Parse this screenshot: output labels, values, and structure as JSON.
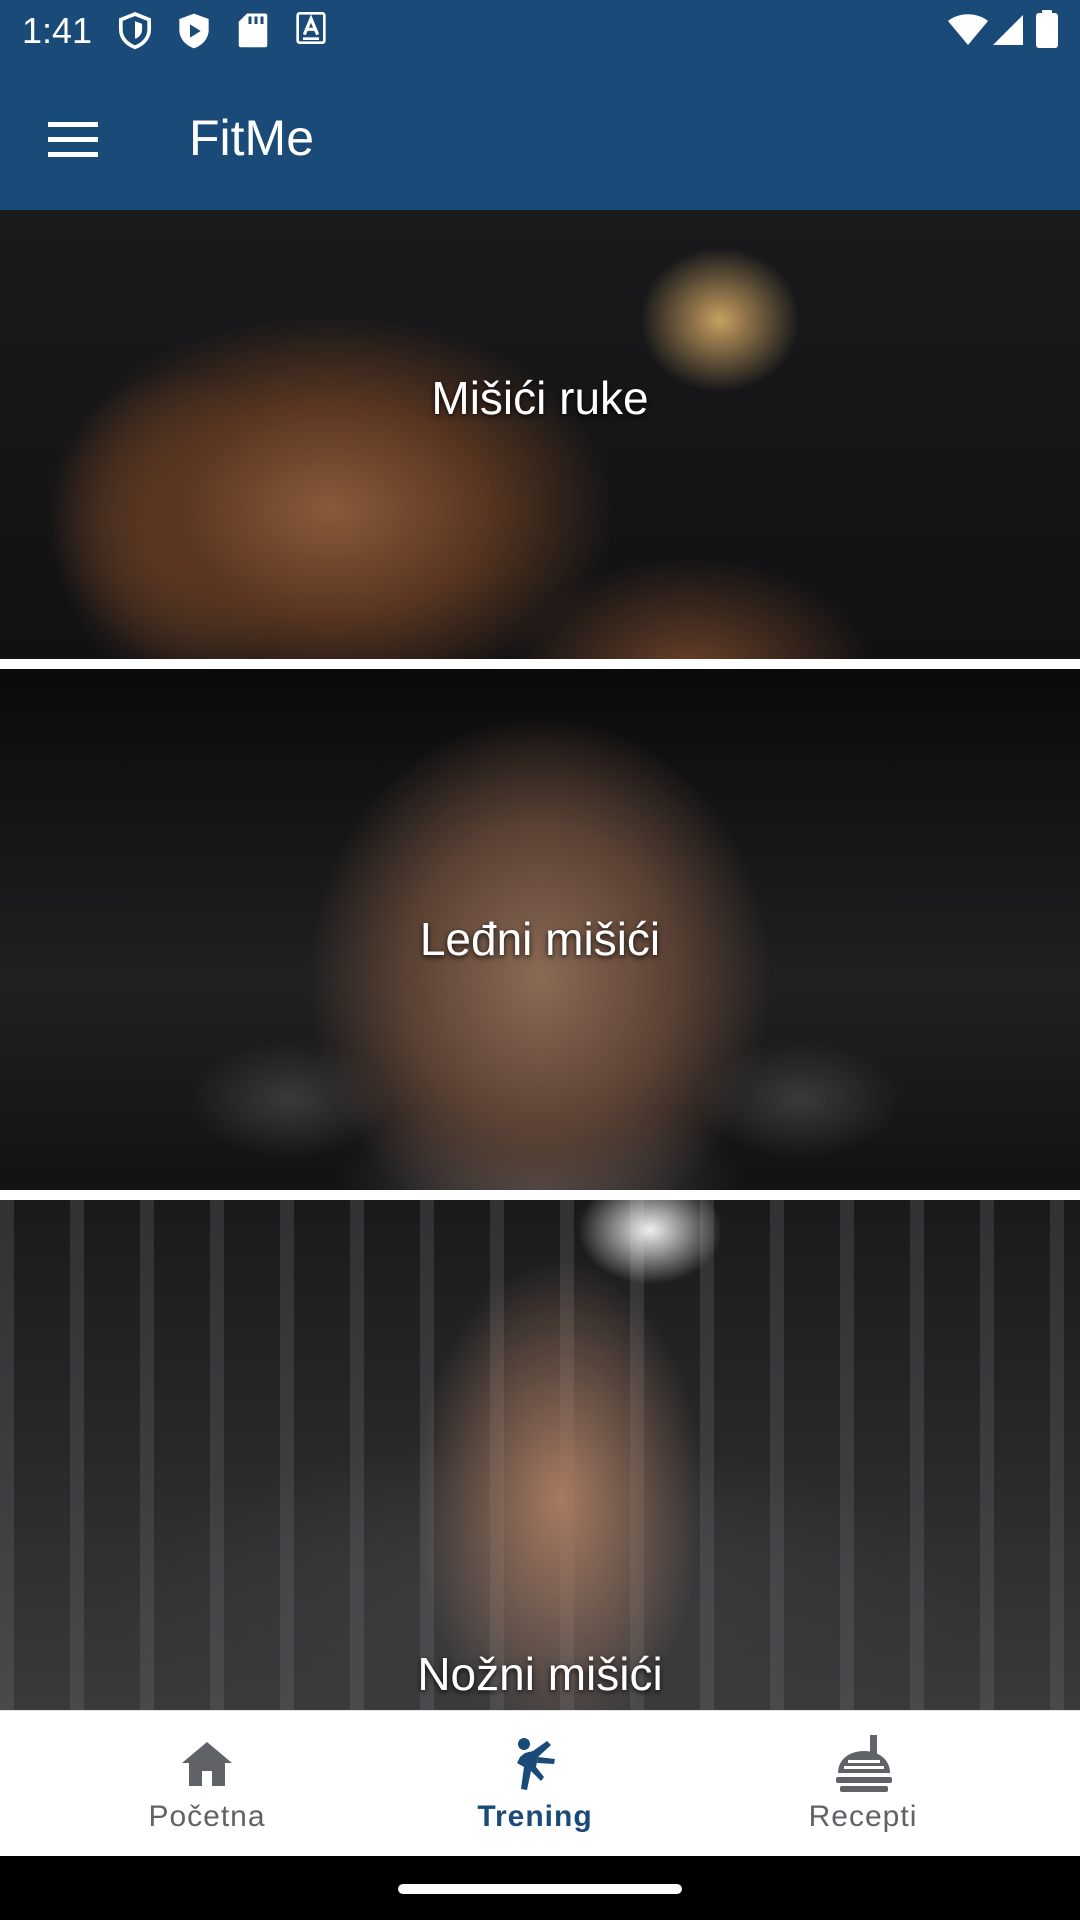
{
  "status_bar": {
    "time": "1:41",
    "left_icons": [
      "shield-icon",
      "play-protect-icon",
      "sd-card-icon",
      "keyboard-a-icon"
    ],
    "right_icons": [
      "wifi-icon",
      "signal-icon",
      "battery-icon"
    ]
  },
  "app_bar": {
    "title": "FitMe",
    "menu_icon": "hamburger-menu-icon"
  },
  "cards": [
    {
      "label": "Mišići ruke"
    },
    {
      "label": "Leđni mišići"
    },
    {
      "label": "Nožni mišići"
    }
  ],
  "bottom_nav": {
    "items": [
      {
        "label": "Početna",
        "icon": "home-icon",
        "active": false
      },
      {
        "label": "Trening",
        "icon": "martial-arts-icon",
        "active": true
      },
      {
        "label": "Recepti",
        "icon": "food-dome-icon",
        "active": false
      }
    ],
    "active_color": "#1a4a78",
    "inactive_color": "#5f6368"
  },
  "colors": {
    "primary": "#1a4a78",
    "on_primary": "#ffffff"
  }
}
